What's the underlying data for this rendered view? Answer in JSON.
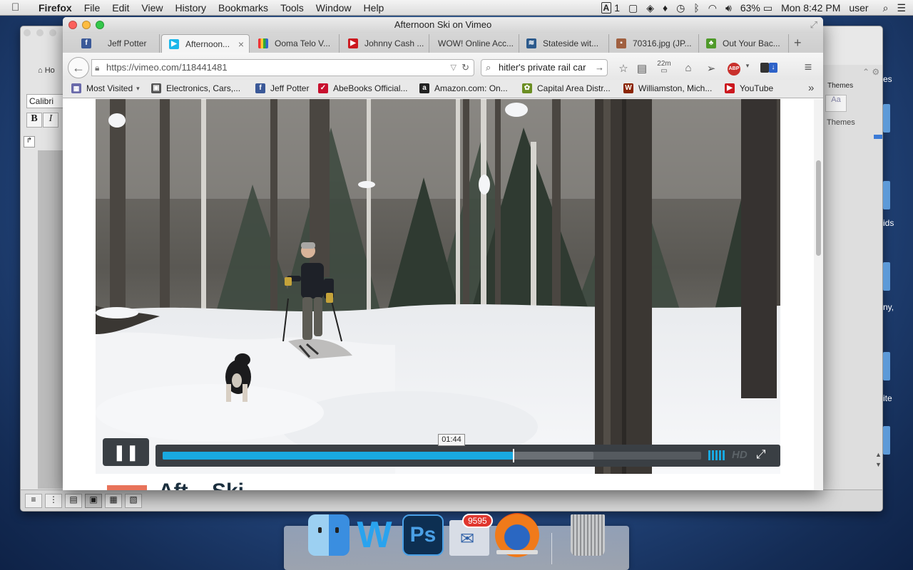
{
  "menubar": {
    "app": "Firefox",
    "items": [
      "File",
      "Edit",
      "View",
      "History",
      "Bookmarks",
      "Tools",
      "Window",
      "Help"
    ],
    "status_input_indicator": "A",
    "status_count": "1",
    "battery": "63%",
    "clock": "Mon 8:42 PM",
    "user": "user"
  },
  "word_window": {
    "font_name": "Calibri",
    "bold_label": "B",
    "italic_label": "I",
    "home_tab": "Ho",
    "themes_title": "Themes",
    "themes_button": "Themes",
    "themes_thumb": "Aa",
    "side_text": [
      "es",
      "ids",
      "ny,",
      "ite"
    ]
  },
  "browser": {
    "window_title": "Afternoon Ski on Vimeo",
    "tabs": [
      {
        "label": "Jeff Potter",
        "icon": "facebook-icon",
        "color": "#3b5998",
        "glyph": "f"
      },
      {
        "label": "Afternoon...",
        "icon": "vimeo-icon",
        "color": "#1ab7ea",
        "glyph": "▶"
      },
      {
        "label": "Ooma Telo V...",
        "icon": "ooma-icon",
        "color": "#444444",
        "glyph": "o"
      },
      {
        "label": "Johnny Cash ...",
        "icon": "youtube-icon",
        "color": "#cc181e",
        "glyph": "▶"
      },
      {
        "label": "WOW! Online Acc...",
        "icon": "",
        "color": "",
        "glyph": ""
      },
      {
        "label": "Stateside wit...",
        "icon": "stateside-icon",
        "color": "#2c5a8c",
        "glyph": "≋"
      },
      {
        "label": "70316.jpg (JP...",
        "icon": "image-icon",
        "color": "#a06040",
        "glyph": "▪"
      },
      {
        "label": "Out Your Bac...",
        "icon": "clover-icon",
        "color": "#4f9a2a",
        "glyph": "♣"
      }
    ],
    "tab_close": "×",
    "new_tab": "+",
    "url": "https://vimeo.com/118441481",
    "url_host": "https://vimeo.com/",
    "url_path": "118441481",
    "search_value": "hitler's private rail car",
    "toolbar_icons": [
      "star-icon",
      "reader-icon",
      "timer-icon",
      "home-icon",
      "send-icon",
      "adblock-icon",
      "extension-icon",
      "menu-icon"
    ],
    "timer_label": "22m",
    "adblock_label": "ABP",
    "bookmarks": [
      {
        "label": "Most Visited",
        "icon": "most-visited-icon",
        "color": "#6a6aaa",
        "glyph": "▦"
      },
      {
        "label": "Electronics, Cars,...",
        "icon": "ebay-icon",
        "color": "#555555",
        "glyph": "▣"
      },
      {
        "label": "Jeff Potter",
        "icon": "facebook-icon",
        "color": "#3b5998",
        "glyph": "f"
      },
      {
        "label": "AbeBooks Official...",
        "icon": "abebooks-icon",
        "color": "#c8102e",
        "glyph": "✓"
      },
      {
        "label": "Amazon.com: On...",
        "icon": "amazon-icon",
        "color": "#222222",
        "glyph": "a"
      },
      {
        "label": "Capital Area Distr...",
        "icon": "cadl-icon",
        "color": "#6b8e23",
        "glyph": "✿"
      },
      {
        "label": "Williamston, Mich...",
        "icon": "williamston-icon",
        "color": "#8b2500",
        "glyph": "W"
      },
      {
        "label": "YouTube",
        "icon": "youtube-icon",
        "color": "#cc181e",
        "glyph": "▶"
      }
    ],
    "bookmarks_overflow": "»"
  },
  "player": {
    "pause_symbol": "❚❚",
    "progress_fraction": 0.65,
    "buffer_fraction": 0.8,
    "time_tooltip": "01:44",
    "hd_label": "HD",
    "fullscreen_symbol": "⤢",
    "page_heading_partial": "Aft    Ski",
    "accent": "#19a9e1"
  },
  "dock": {
    "apps": [
      {
        "name": "Finder",
        "icon": "finder-icon"
      },
      {
        "name": "Word",
        "icon": "word-icon",
        "glyph": "W"
      },
      {
        "name": "Photoshop",
        "icon": "photoshop-icon",
        "glyph": "Ps"
      },
      {
        "name": "Mail",
        "icon": "mail-icon",
        "badge": "9595"
      },
      {
        "name": "Firefox",
        "icon": "firefox-icon"
      },
      {
        "name": "Trash",
        "icon": "trash-icon"
      }
    ]
  }
}
